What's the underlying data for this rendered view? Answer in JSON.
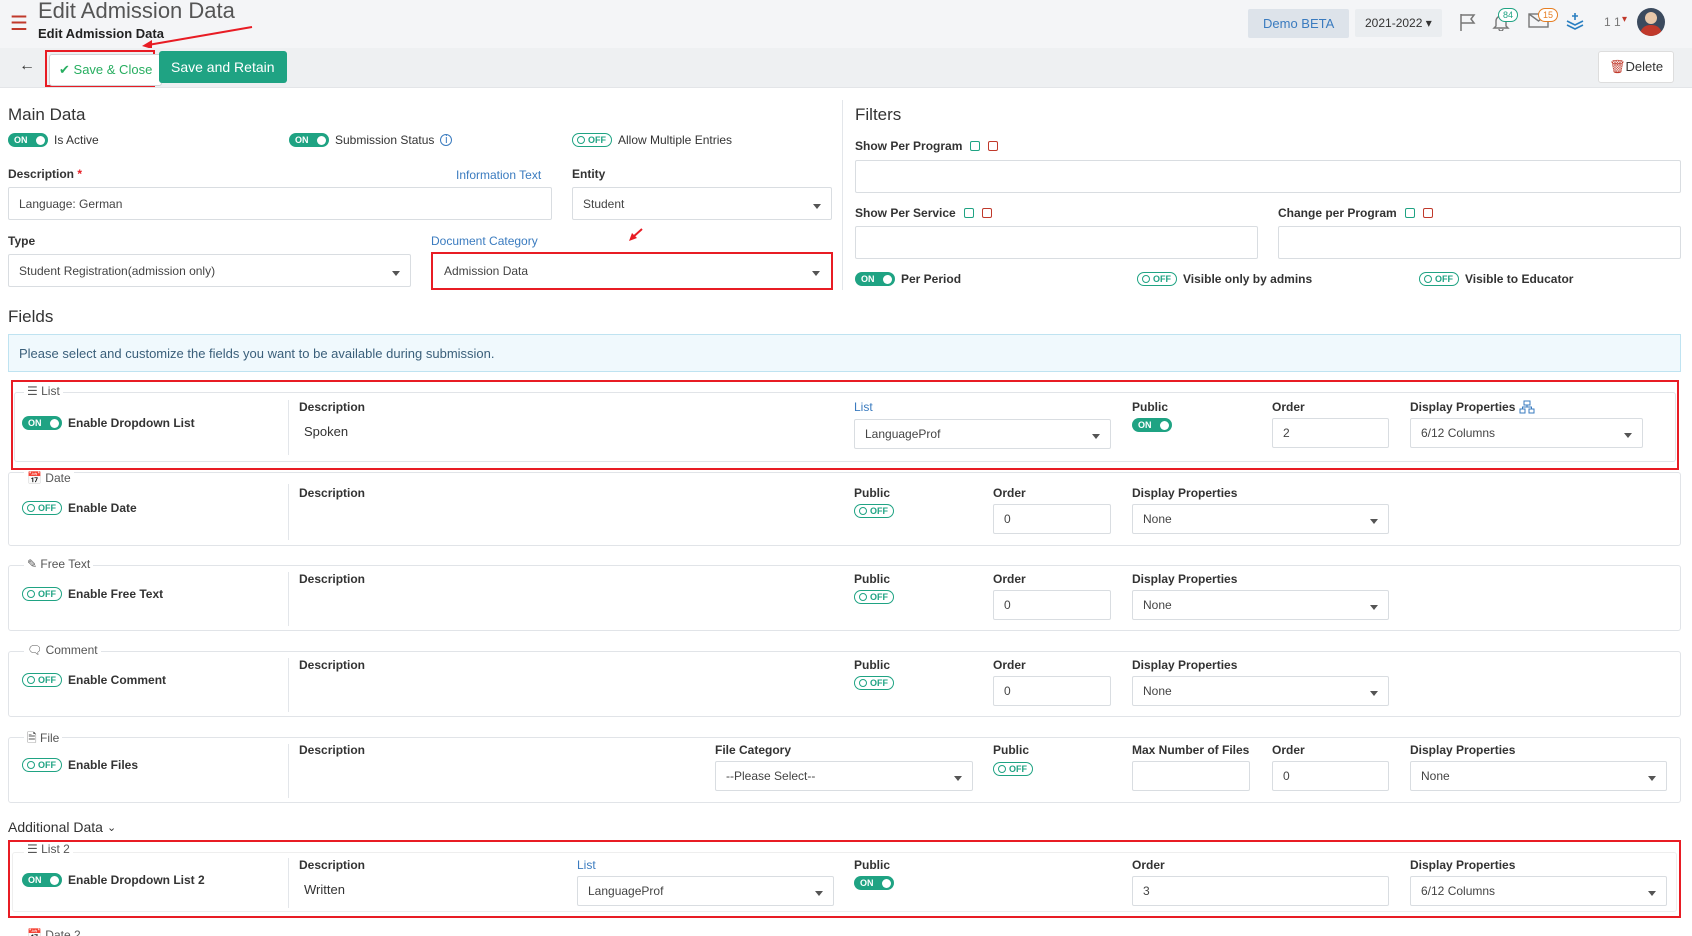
{
  "header": {
    "title": "Edit Admission Data",
    "subtitle": "Edit Admission Data",
    "org": "Demo BETA",
    "year": "2021-2022",
    "notif_count": "84",
    "mail_count": "15",
    "user_short": "1 1"
  },
  "toolbar": {
    "save_close": "Save & Close",
    "save_retain": "Save and Retain",
    "delete": "Delete"
  },
  "main": {
    "title": "Main Data",
    "is_active_label": "Is Active",
    "submission_status_label": "Submission Status",
    "allow_multiple_label": "Allow Multiple Entries",
    "description_label": "Description",
    "description_value": "Language: German",
    "info_text": "Information Text",
    "entity_label": "Entity",
    "entity_value": "Student",
    "type_label": "Type",
    "type_value": "Student Registration(admission only)",
    "doc_cat_label": "Document Category",
    "doc_cat_value": "Admission Data"
  },
  "filters": {
    "title": "Filters",
    "show_per_program": "Show Per Program",
    "show_per_service": "Show Per Service",
    "change_per_program": "Change per Program",
    "per_period": "Per Period",
    "visible_admins": "Visible only by admins",
    "visible_educator": "Visible to Educator"
  },
  "toggle": {
    "on": "ON",
    "off": "OFF"
  },
  "fields": {
    "title": "Fields",
    "info": "Please select and customize the fields you want to be available during submission.",
    "list": {
      "legend": "List",
      "enable": "Enable Dropdown List",
      "desc_label": "Description",
      "desc_value": "Spoken",
      "list_label": "List",
      "list_value": "LanguageProf",
      "public_label": "Public",
      "order_label": "Order",
      "order_value": "2",
      "display_label": "Display Properties",
      "display_value": "6/12 Columns"
    },
    "date": {
      "legend": "Date",
      "enable": "Enable Date",
      "desc_label": "Description",
      "public_label": "Public",
      "order_label": "Order",
      "order_value": "0",
      "display_label": "Display Properties",
      "display_value": "None"
    },
    "free_text": {
      "legend": "Free Text",
      "enable": "Enable Free Text",
      "desc_label": "Description",
      "public_label": "Public",
      "order_label": "Order",
      "order_value": "0",
      "display_label": "Display Properties",
      "display_value": "None"
    },
    "comment": {
      "legend": "Comment",
      "enable": "Enable Comment",
      "desc_label": "Description",
      "public_label": "Public",
      "order_label": "Order",
      "order_value": "0",
      "display_label": "Display Properties",
      "display_value": "None"
    },
    "file": {
      "legend": "File",
      "enable": "Enable Files",
      "desc_label": "Description",
      "file_cat_label": "File Category",
      "file_cat_value": "--Please Select--",
      "public_label": "Public",
      "max_label": "Max Number of Files",
      "order_label": "Order",
      "order_value": "0",
      "display_label": "Display Properties",
      "display_value": "None"
    }
  },
  "additional": {
    "title": "Additional Data",
    "list2": {
      "legend": "List 2",
      "enable": "Enable Dropdown List 2",
      "desc_label": "Description",
      "desc_value": "Written",
      "list_label": "List",
      "list_value": "LanguageProf",
      "public_label": "Public",
      "order_label": "Order",
      "order_value": "3",
      "display_label": "Display Properties",
      "display_value": "6/12 Columns"
    },
    "next_legend": "Date 2"
  }
}
